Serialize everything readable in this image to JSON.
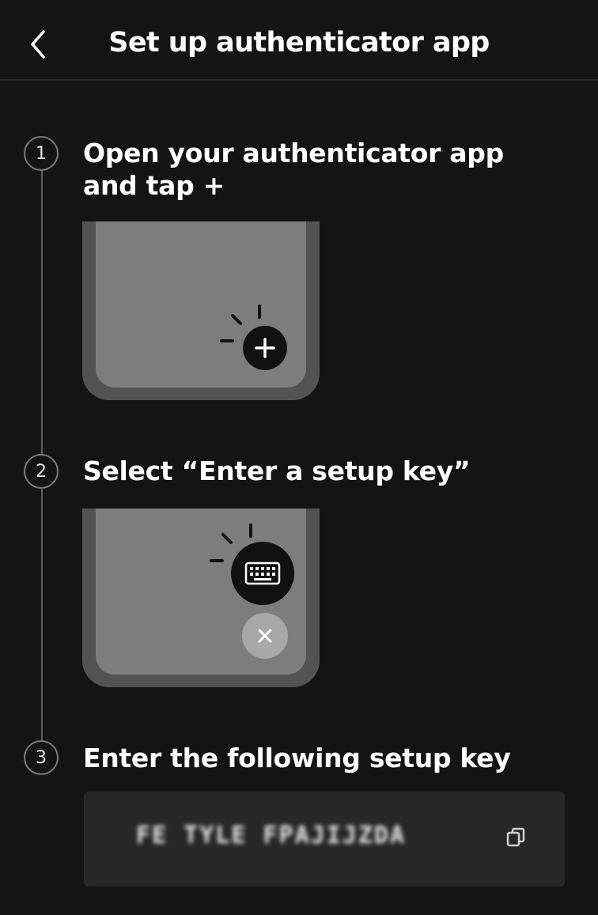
{
  "header": {
    "title": "Set up authenticator app",
    "back_icon": "chevron-left-icon"
  },
  "steps": [
    {
      "number": "1",
      "text": "Open your authenticator app and tap +"
    },
    {
      "number": "2",
      "text": "Select “Enter a setup key”"
    },
    {
      "number": "3",
      "text": "Enter the following setup key"
    }
  ],
  "illustrations": {
    "step1_button_icon": "plus-icon",
    "step2_button_icon": "keyboard-icon",
    "step2_secondary_icon": "close-icon"
  },
  "setup_key": {
    "value": "FE TYLE FPAJIJZDA",
    "copy_icon": "copy-icon"
  },
  "colors": {
    "background": "#141414",
    "phone_body": "#535353",
    "phone_screen": "#7d7d7d",
    "key_box": "#272727"
  }
}
